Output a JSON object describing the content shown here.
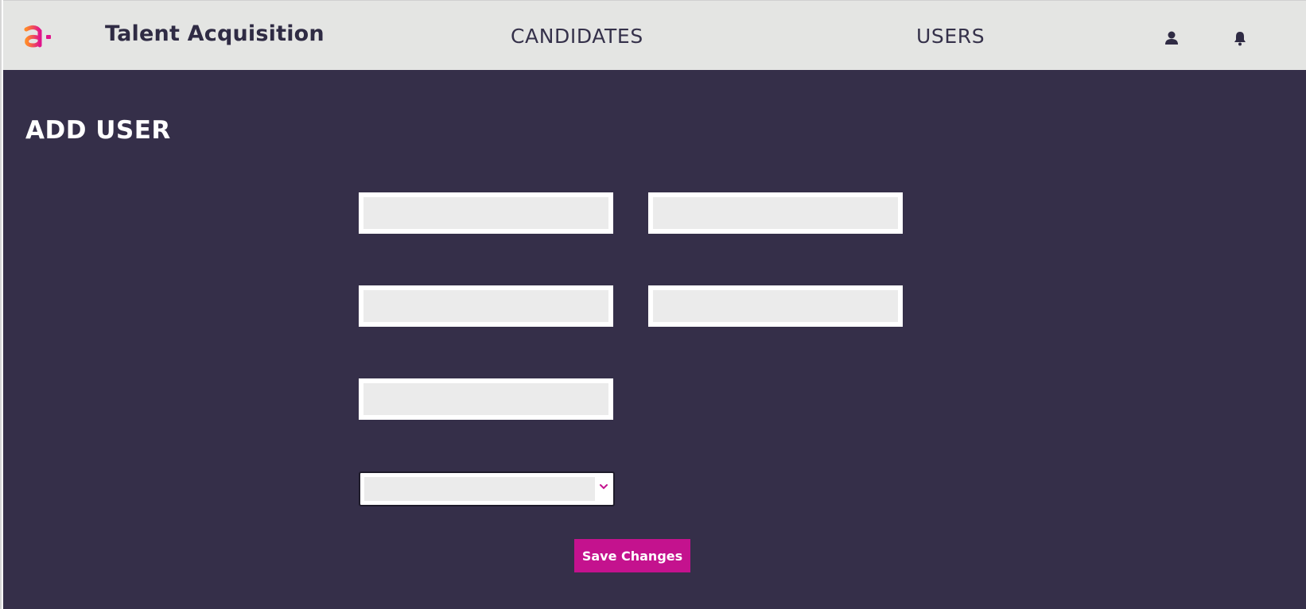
{
  "header": {
    "app_title": "Talent Acquisition",
    "nav": [
      {
        "label": "CANDIDATES"
      },
      {
        "label": "USERS"
      }
    ],
    "icons": {
      "logo": "brand-logo-icon",
      "user": "user-icon",
      "notifications": "bell-icon"
    }
  },
  "main": {
    "page_title": "ADD USER",
    "fields": [
      {
        "value": "",
        "placeholder": ""
      },
      {
        "value": "",
        "placeholder": ""
      },
      {
        "value": "",
        "placeholder": ""
      },
      {
        "value": "",
        "placeholder": ""
      },
      {
        "value": "",
        "placeholder": ""
      }
    ],
    "dropdown": {
      "selected": ""
    },
    "save_label": "Save Changes"
  },
  "colors": {
    "header_bg": "#e4e5e3",
    "main_bg": "#352f49",
    "accent": "#c4128e",
    "logo_gradient_start": "#ff8a2a",
    "logo_gradient_end": "#e0158b"
  }
}
